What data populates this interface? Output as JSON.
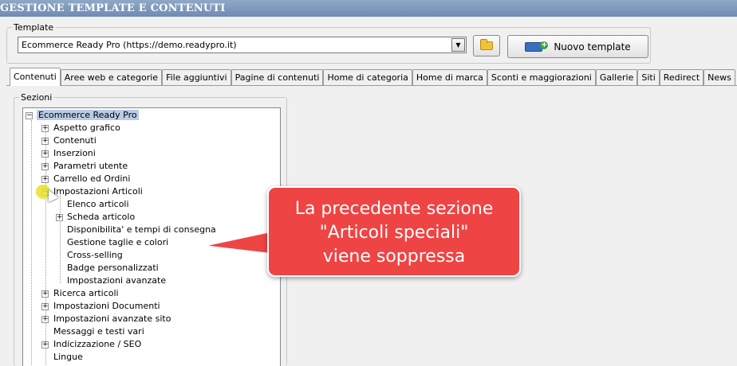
{
  "window": {
    "title": "GESTIONE TEMPLATE E CONTENUTI"
  },
  "template": {
    "legend": "Template",
    "selected": "Ecommerce Ready Pro (https://demo.readypro.it)",
    "new_button": "Nuovo template"
  },
  "tabs": [
    {
      "label": "Contenuti"
    },
    {
      "label": "Aree web e categorie"
    },
    {
      "label": "File aggiuntivi"
    },
    {
      "label": "Pagine di contenuti"
    },
    {
      "label": "Home di categoria"
    },
    {
      "label": "Home di marca"
    },
    {
      "label": "Sconti e maggiorazioni"
    },
    {
      "label": "Gallerie"
    },
    {
      "label": "Siti"
    },
    {
      "label": "Redirect"
    },
    {
      "label": "News"
    }
  ],
  "sections": {
    "legend": "Sezioni",
    "root": "Ecommerce Ready Pro",
    "items": [
      {
        "label": "Aspetto grafico"
      },
      {
        "label": "Contenuti"
      },
      {
        "label": "Inserzioni"
      },
      {
        "label": "Parametri utente"
      },
      {
        "label": "Carrello ed Ordini"
      },
      {
        "label": "Impostazioni Articoli"
      },
      {
        "label": "Elenco articoli"
      },
      {
        "label": "Scheda articolo"
      },
      {
        "label": "Disponibilita' e tempi di consegna"
      },
      {
        "label": "Gestione taglie e colori"
      },
      {
        "label": "Cross-selling"
      },
      {
        "label": "Badge personalizzati"
      },
      {
        "label": "Impostazioni avanzate"
      },
      {
        "label": "Ricerca articoli"
      },
      {
        "label": "Impostazioni Documenti"
      },
      {
        "label": "Impostazioni avanzate sito"
      },
      {
        "label": "Messaggi e testi vari"
      },
      {
        "label": "Indicizzazione / SEO"
      },
      {
        "label": "Lingue"
      }
    ]
  },
  "callout": {
    "line1": "La precedente sezione",
    "line2": "\"Articoli speciali\"",
    "line3": "viene soppressa",
    "color": "#ef4444"
  }
}
